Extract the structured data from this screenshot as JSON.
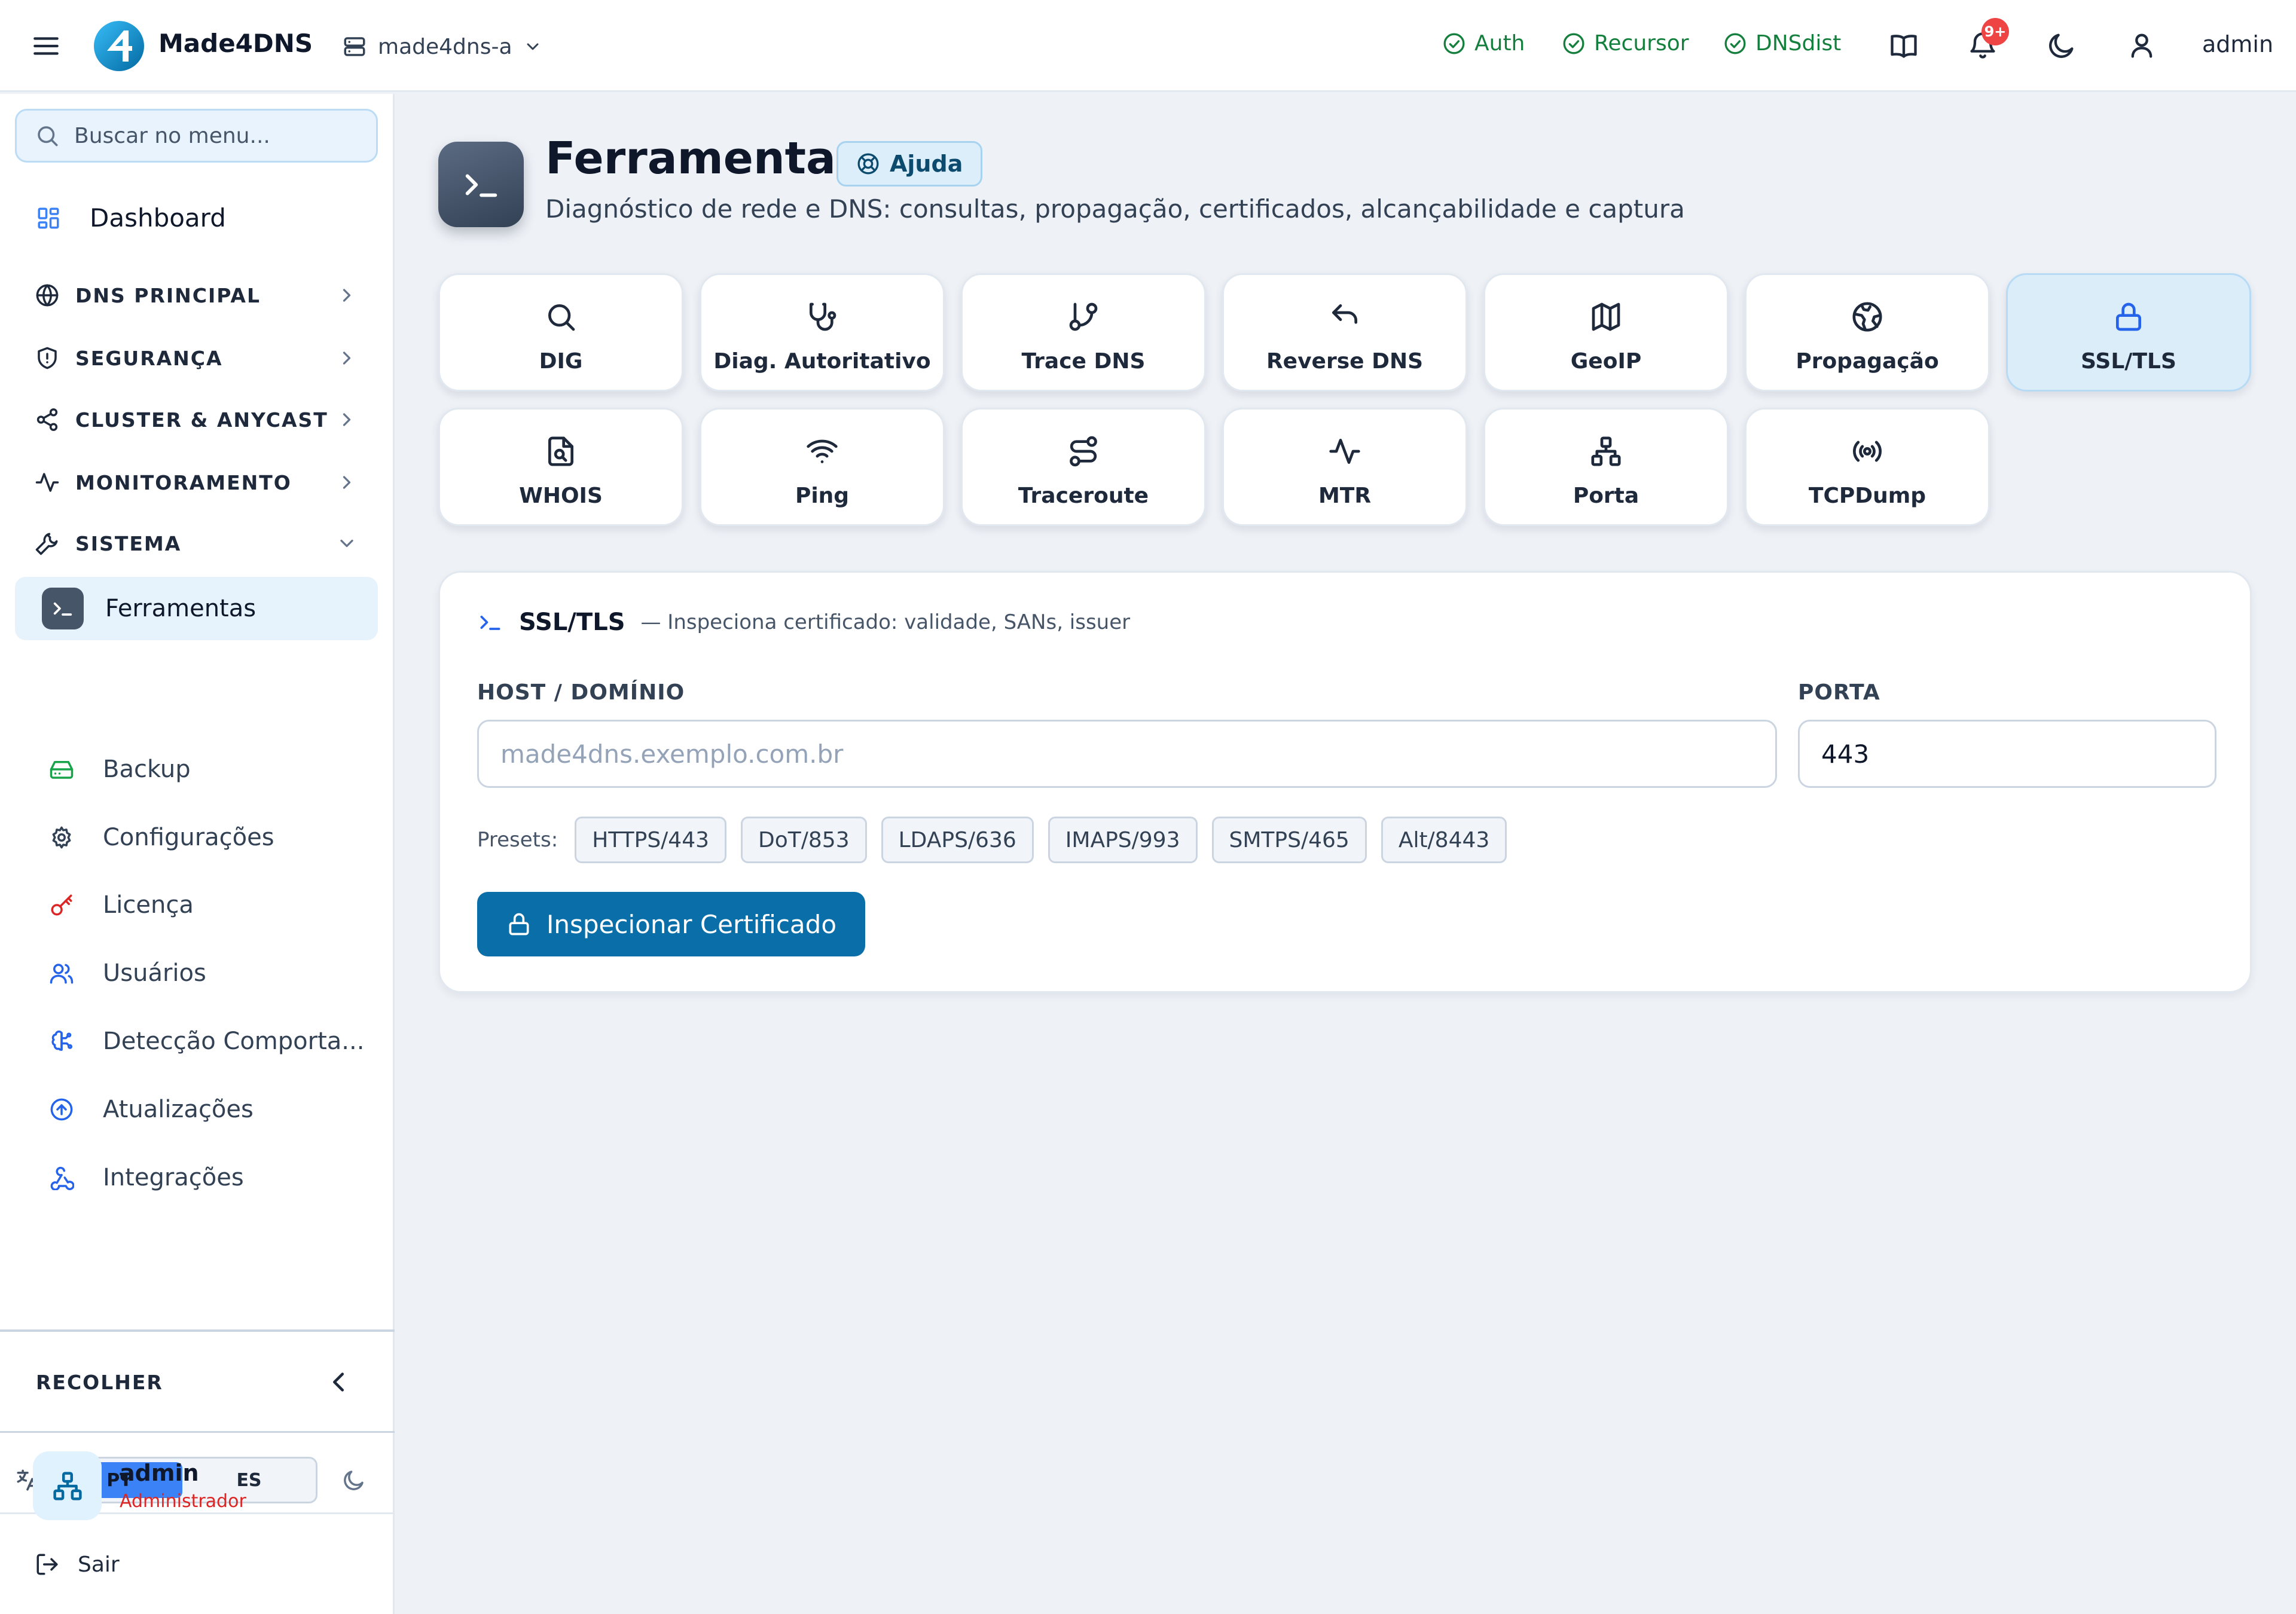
{
  "app": {
    "name": "Made4DNS",
    "server": "made4dns-a",
    "user": "admin"
  },
  "topbar": {
    "statuses": [
      "Auth",
      "Recursor",
      "DNSdist"
    ],
    "notif_badge": "9+",
    "icons": [
      "book-icon",
      "bell-icon",
      "moon-icon",
      "user-icon"
    ]
  },
  "sidebar": {
    "search_placeholder": "Buscar no menu...",
    "dashboard": "Dashboard",
    "sections": [
      "DNS PRINCIPAL",
      "SEGURANÇA",
      "CLUSTER & ANYCAST",
      "MONITORAMENTO",
      "SISTEMA"
    ],
    "system_items": [
      "Ferramentas",
      "Backup",
      "Configurações",
      "Licença",
      "Usuários",
      "Detecção Comporta...",
      "Atualizações",
      "Integrações"
    ],
    "active_item": "Ferramentas",
    "collapse": "RECOLHER",
    "languages": [
      "PT",
      "ES"
    ],
    "active_language": "PT",
    "user": {
      "name": "admin",
      "role": "Administrador"
    },
    "logout": "Sair"
  },
  "page": {
    "title": "Ferramentas",
    "help": "Ajuda",
    "subtitle": "Diagnóstico de rede e DNS: consultas, propagação, certificados, alcançabilidade e captura"
  },
  "tools": [
    "DIG",
    "Diag. Autoritativo",
    "Trace DNS",
    "Reverse DNS",
    "GeoIP",
    "Propagação",
    "SSL/TLS",
    "WHOIS",
    "Ping",
    "Traceroute",
    "MTR",
    "Porta",
    "TCPDump"
  ],
  "active_tool": "SSL/TLS",
  "panel": {
    "title": "SSL/TLS",
    "description": "— Inspeciona certificado: validade, SANs, issuer",
    "host_label": "HOST / DOMÍNIO",
    "host_placeholder": "made4dns.exemplo.com.br",
    "host_value": "",
    "port_label": "PORTA",
    "port_value": "443",
    "presets_label": "Presets:",
    "presets": [
      "HTTPS/443",
      "DoT/853",
      "LDAPS/636",
      "IMAPS/993",
      "SMTPS/465",
      "Alt/8443"
    ],
    "submit": "Inspecionar Certificado"
  },
  "colors": {
    "brand": "#0a6ea8",
    "accent": "#3b82f6",
    "status_ok": "#15803d",
    "badge": "#ef4444",
    "role": "#dc2626"
  }
}
